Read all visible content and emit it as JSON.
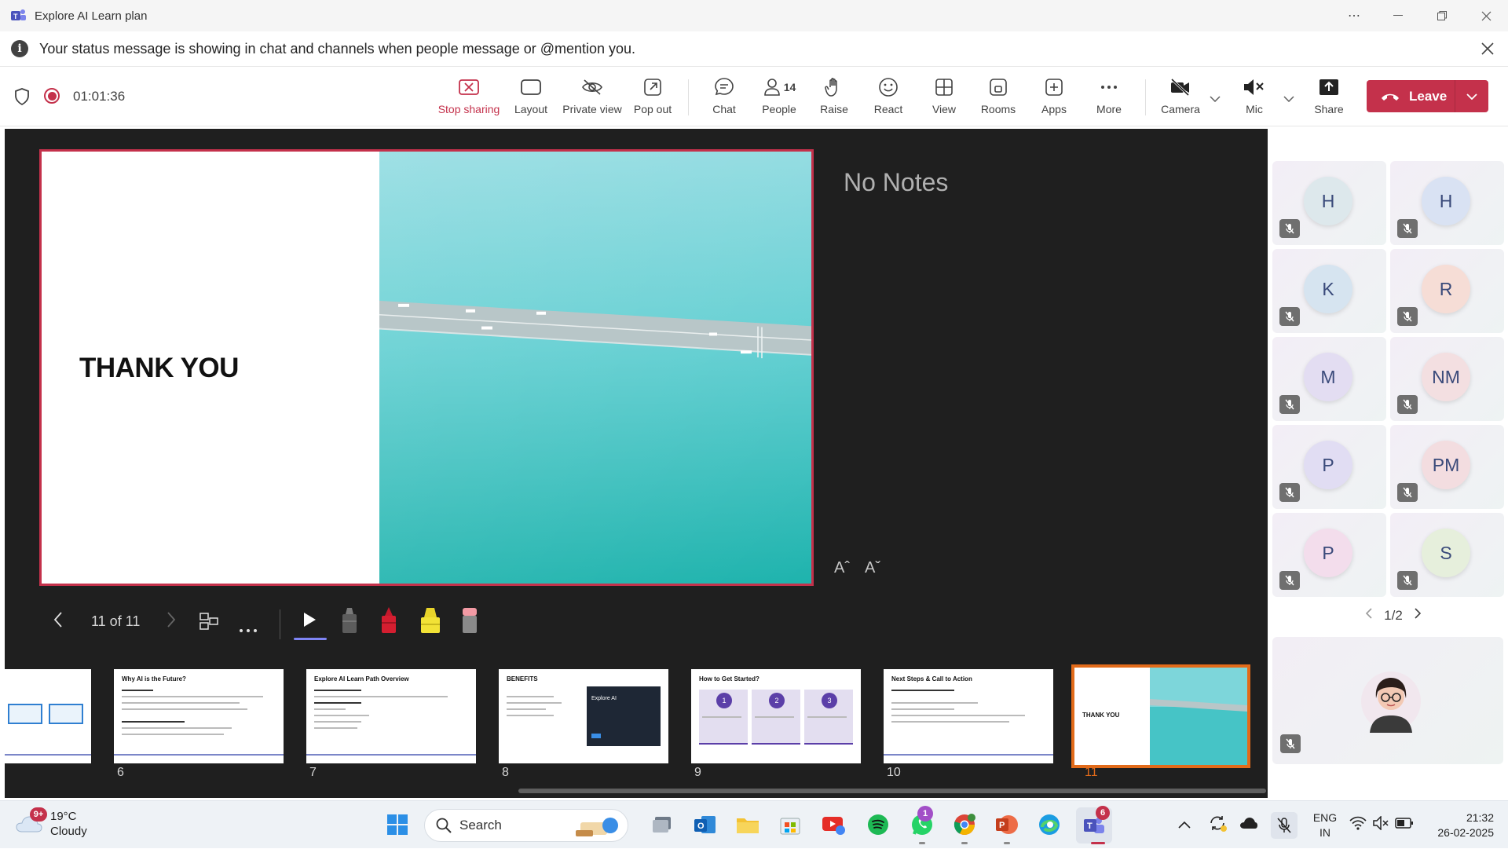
{
  "window": {
    "title": "Explore AI Learn plan",
    "more_icon": "ellipsis-icon",
    "controls": [
      "minimize-icon",
      "restore-icon",
      "close-icon"
    ]
  },
  "banner": {
    "message": "Your status message is showing in chat and channels when people message or @mention you."
  },
  "meeting": {
    "elapsed": "01:01:36",
    "toolbar": {
      "stop_sharing": "Stop sharing",
      "layout": "Layout",
      "private_view": "Private view",
      "pop_out": "Pop out",
      "chat": "Chat",
      "people": "People",
      "people_count": "14",
      "raise": "Raise",
      "react": "React",
      "view": "View",
      "rooms": "Rooms",
      "apps": "Apps",
      "more": "More",
      "camera": "Camera",
      "mic": "Mic",
      "share": "Share",
      "leave": "Leave"
    },
    "accent": "#c4314b"
  },
  "presentation": {
    "slide_title": "THANK YOU",
    "notes": "No Notes",
    "font_increase": "Aˆ",
    "font_decrease": "Aˇ",
    "counter": "11 of 11",
    "thumbnails": [
      {
        "number": "",
        "title": ""
      },
      {
        "number": "6",
        "title": "Why AI is the Future?"
      },
      {
        "number": "7",
        "title": "Explore AI Learn Path Overview"
      },
      {
        "number": "8",
        "title": "BENEFITS"
      },
      {
        "number": "9",
        "title": "How to Get Started?"
      },
      {
        "number": "10",
        "title": "Next Steps & Call to Action"
      },
      {
        "number": "11",
        "title": "THANK YOU"
      }
    ],
    "thumb_detail": {
      "benefits_card": "Explore AI",
      "steps": [
        "1",
        "2",
        "3"
      ]
    }
  },
  "participants": {
    "tiles": [
      {
        "initials": "H",
        "bg": "#dde8ec"
      },
      {
        "initials": "H",
        "bg": "#d9e2f3"
      },
      {
        "initials": "K",
        "bg": "#d6e4f0"
      },
      {
        "initials": "R",
        "bg": "#f6ddd6"
      },
      {
        "initials": "M",
        "bg": "#e3ddf2"
      },
      {
        "initials": "NM",
        "bg": "#f3dfe1"
      },
      {
        "initials": "P",
        "bg": "#e1ddf3"
      },
      {
        "initials": "PM",
        "bg": "#f3dde0"
      },
      {
        "initials": "P",
        "bg": "#f3ddec"
      },
      {
        "initials": "S",
        "bg": "#e6efdc"
      }
    ],
    "page": "1/2"
  },
  "taskbar": {
    "temp": "19°C",
    "condition": "Cloudy",
    "weather_badge": "9+",
    "search": "Search",
    "whatsapp_badge": "1",
    "teams_badge": "6",
    "lang1": "ENG",
    "lang2": "IN",
    "time": "21:32",
    "date": "26-02-2025"
  }
}
